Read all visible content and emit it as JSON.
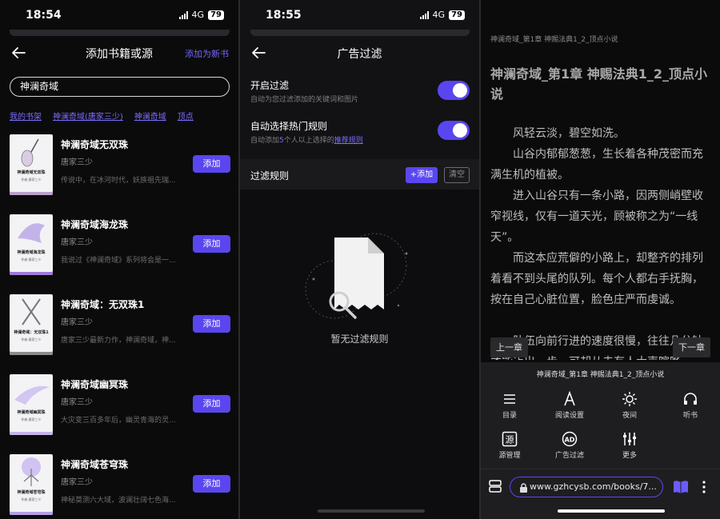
{
  "panel1": {
    "status": {
      "time": "18:54",
      "network": "4G",
      "battery": "79"
    },
    "header": {
      "title": "添加书籍或源",
      "add_new_link": "添加为新书"
    },
    "search": {
      "value": "神澜奇域"
    },
    "chips": [
      "我的书架",
      "神澜奇域(唐家三少)",
      "神澜奇域",
      "顶点"
    ],
    "add_label": "添加",
    "books": [
      {
        "name": "神澜奇域无双珠",
        "author": "唐家三少",
        "desc": "传说中，在冰河时代，妖族祖先瑞...",
        "cover_title": "神澜奇域无双珠",
        "cover_sub": "作者:唐家三少",
        "cover_color": "#b9a1c9"
      },
      {
        "name": "神澜奇域海龙珠",
        "author": "唐家三少",
        "desc": "我说过《神澜奇域》系列将会是一...",
        "cover_title": "神澜奇域海龙珠",
        "cover_sub": "作者:唐家三少",
        "cover_color": "#9d7bd8"
      },
      {
        "name": "神澜奇域：无双珠1",
        "author": "唐家三少",
        "desc": "唐家三少最新力作，神澜奇域，神...",
        "cover_title": "神澜奇域：无双珠1",
        "cover_sub": "作者:唐家三少",
        "cover_color": "#8c8c8c"
      },
      {
        "name": "神澜奇域幽冥珠",
        "author": "唐家三少",
        "desc": "大灾变三百多年后，幽灵青海的灵...",
        "cover_title": "神澜奇域幽冥珠",
        "cover_sub": "作者:唐家三少",
        "cover_color": "#c6b4e8"
      },
      {
        "name": "神澜奇域苍穹珠",
        "author": "唐家三少",
        "desc": "神秘莫测六大域，波澜壮阔七色海...",
        "cover_title": "神澜奇域苍穹珠",
        "cover_sub": "作者:唐家三少",
        "cover_color": "#b49fe6"
      }
    ]
  },
  "panel2": {
    "status": {
      "time": "18:55",
      "network": "4G",
      "battery": "79"
    },
    "header": {
      "title": "广告过滤"
    },
    "enable": {
      "label": "开启过滤",
      "sub": "自动为您过滤添加的关键词和图片",
      "on": true
    },
    "auto": {
      "label": "自动选择热门规则",
      "sub_a": "自动添加",
      "sub_num": "5",
      "sub_b": "个人以上选择的",
      "sub_link": "推荐规则",
      "on": true
    },
    "rules": {
      "label": "过滤规则",
      "add": "+添加",
      "clear": "清空"
    },
    "empty": "暂无过滤规则"
  },
  "panel3": {
    "crumb": "神澜奇域_第1章 神赐法典1_2_顶点小说",
    "chapter_title": "神澜奇域_第1章 神赐法典1_2_顶点小说",
    "paragraphs": [
      "风轻云淡，碧空如洗。",
      "山谷内郁郁葱葱，生长着各种茂密而充满生机的植被。",
      "进入山谷只有一条小路，因两侧峭壁收窄视线，仅有一道天光，顾被称之为“一线天”。",
      "而这本应荒僻的小路上，却整齐的排列着看不到头尾的队列。每个人都右手抚胸，按在自己心脏位置，脸色庄严而虔诚。",
      "队伍向前行进的速度很慢，往往几分钟才能迈出一步。可却从未有人大声喧哗"
    ],
    "prev": "上一章",
    "next": "下一章",
    "menu_title": "神澜奇域_第1章 神赐法典1_2_顶点小说",
    "menu": {
      "toc": "目录",
      "reading": "阅读设置",
      "night": "夜间",
      "listen": "听书",
      "source": "源管理",
      "adfilter": "广告过滤",
      "more": "更多"
    },
    "url": "www.gzhcysb.com/books/7..."
  }
}
